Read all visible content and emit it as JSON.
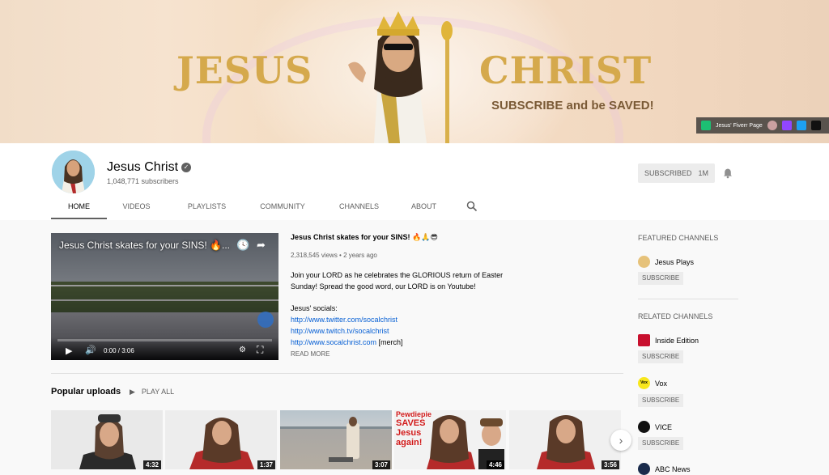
{
  "banner": {
    "left_word": "JESUS",
    "right_word": "CHRIST",
    "tagline": "SUBSCRIBE and be SAVED!",
    "link_label": "Jesus' Fiverr Page"
  },
  "channel": {
    "name": "Jesus Christ",
    "subscribers": "1,048,771 subscribers",
    "subscribe_label": "SUBSCRIBED",
    "subscribe_count": "1M"
  },
  "tabs": [
    {
      "label": "HOME"
    },
    {
      "label": "VIDEOS"
    },
    {
      "label": "PLAYLISTS"
    },
    {
      "label": "COMMUNITY"
    },
    {
      "label": "CHANNELS"
    },
    {
      "label": "ABOUT"
    }
  ],
  "featured_video": {
    "player_title": "Jesus Christ skates for your SINS! 🔥...",
    "time": "0:00 / 3:06",
    "progress": 0.0,
    "title": "Jesus Christ skates for your SINS! 🔥🙏😎",
    "meta": "2,318,545 views • 2 years ago",
    "desc_line1": "Join your LORD as he celebrates the GLORIOUS return of Easter",
    "desc_line2": "Sunday! Spread the good word, our LORD is on Youtube!",
    "socials_label": "Jesus' socials:",
    "link1": "http://www.twitter.com/socalchrist",
    "link2": "http://www.twitch.tv/socalchrist",
    "link3": "http://www.socalchrist.com",
    "link3_suffix": " [merch]",
    "read_more": "READ MORE"
  },
  "popular": {
    "title": "Popular uploads",
    "play_all": "PLAY ALL",
    "thumbs": [
      {
        "duration": "4:32"
      },
      {
        "duration": "1:37"
      },
      {
        "duration": "3:07"
      },
      {
        "duration": "4:46",
        "overlay_line1": "Pewdiepie",
        "overlay_line2": "SAVES",
        "overlay_line3": "Jesus",
        "overlay_line4": "again!"
      },
      {
        "duration": "3:56"
      }
    ]
  },
  "sidebar": {
    "featured_heading": "FEATURED CHANNELS",
    "featured": [
      {
        "name": "Jesus Plays",
        "button": "SUBSCRIBE"
      }
    ],
    "related_heading": "RELATED CHANNELS",
    "related": [
      {
        "name": "Inside Edition",
        "button": "SUBSCRIBE"
      },
      {
        "name": "Vox",
        "button": "SUBSCRIBE",
        "icon_text": "Vox"
      },
      {
        "name": "VICE",
        "button": "SUBSCRIBE"
      },
      {
        "name": "ABC News"
      }
    ]
  },
  "colors": {
    "banner_gold": "#d5a94c",
    "link_blue": "#065fd4",
    "progress_red": "#cc0000"
  }
}
